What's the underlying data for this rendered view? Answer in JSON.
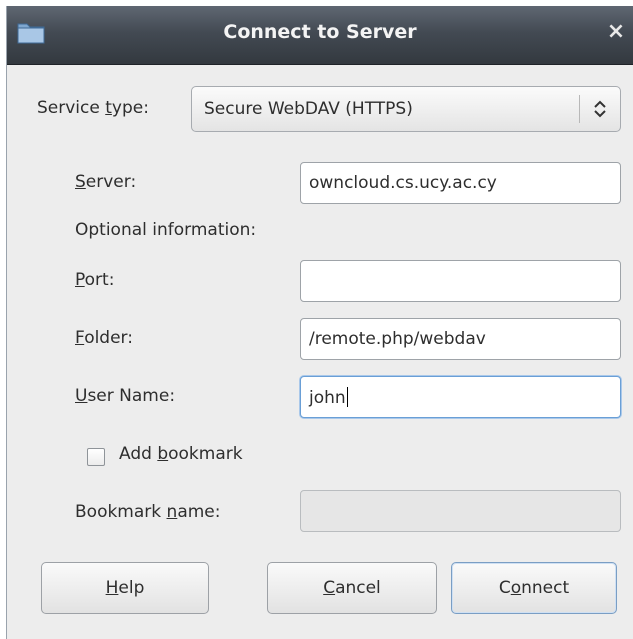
{
  "window": {
    "title": "Connect to Server",
    "close_glyph": "×",
    "icon": "folder-icon"
  },
  "service": {
    "label_pre": "Service ",
    "label_mnemonic": "t",
    "label_post": "ype:",
    "selected": "Secure WebDAV (HTTPS)"
  },
  "server": {
    "label_mnemonic": "S",
    "label_post": "erver:",
    "value": "owncloud.cs.ucy.ac.cy"
  },
  "optional_heading": "Optional information:",
  "port": {
    "label_mnemonic": "P",
    "label_post": "ort:",
    "value": ""
  },
  "folder": {
    "label_mnemonic": "F",
    "label_post": "older:",
    "value": "/remote.php/webdav"
  },
  "username": {
    "label_mnemonic": "U",
    "label_post": "ser Name:",
    "value": "john"
  },
  "bookmark_check": {
    "label_pre": "Add ",
    "label_mnemonic": "b",
    "label_post": "ookmark",
    "checked": false
  },
  "bookmark_name": {
    "label_pre": "Bookmark ",
    "label_mnemonic": "n",
    "label_post": "ame:",
    "value": ""
  },
  "buttons": {
    "help": {
      "mnemonic": "H",
      "rest": "elp"
    },
    "cancel": {
      "mnemonic": "C",
      "rest": "ancel"
    },
    "connect": {
      "pre": "C",
      "mnemonic": "o",
      "rest": "nnect"
    }
  },
  "colors": {
    "titlebar": "#434a53",
    "dialog_bg": "#ededed",
    "focus_ring": "#6a9fd6"
  }
}
